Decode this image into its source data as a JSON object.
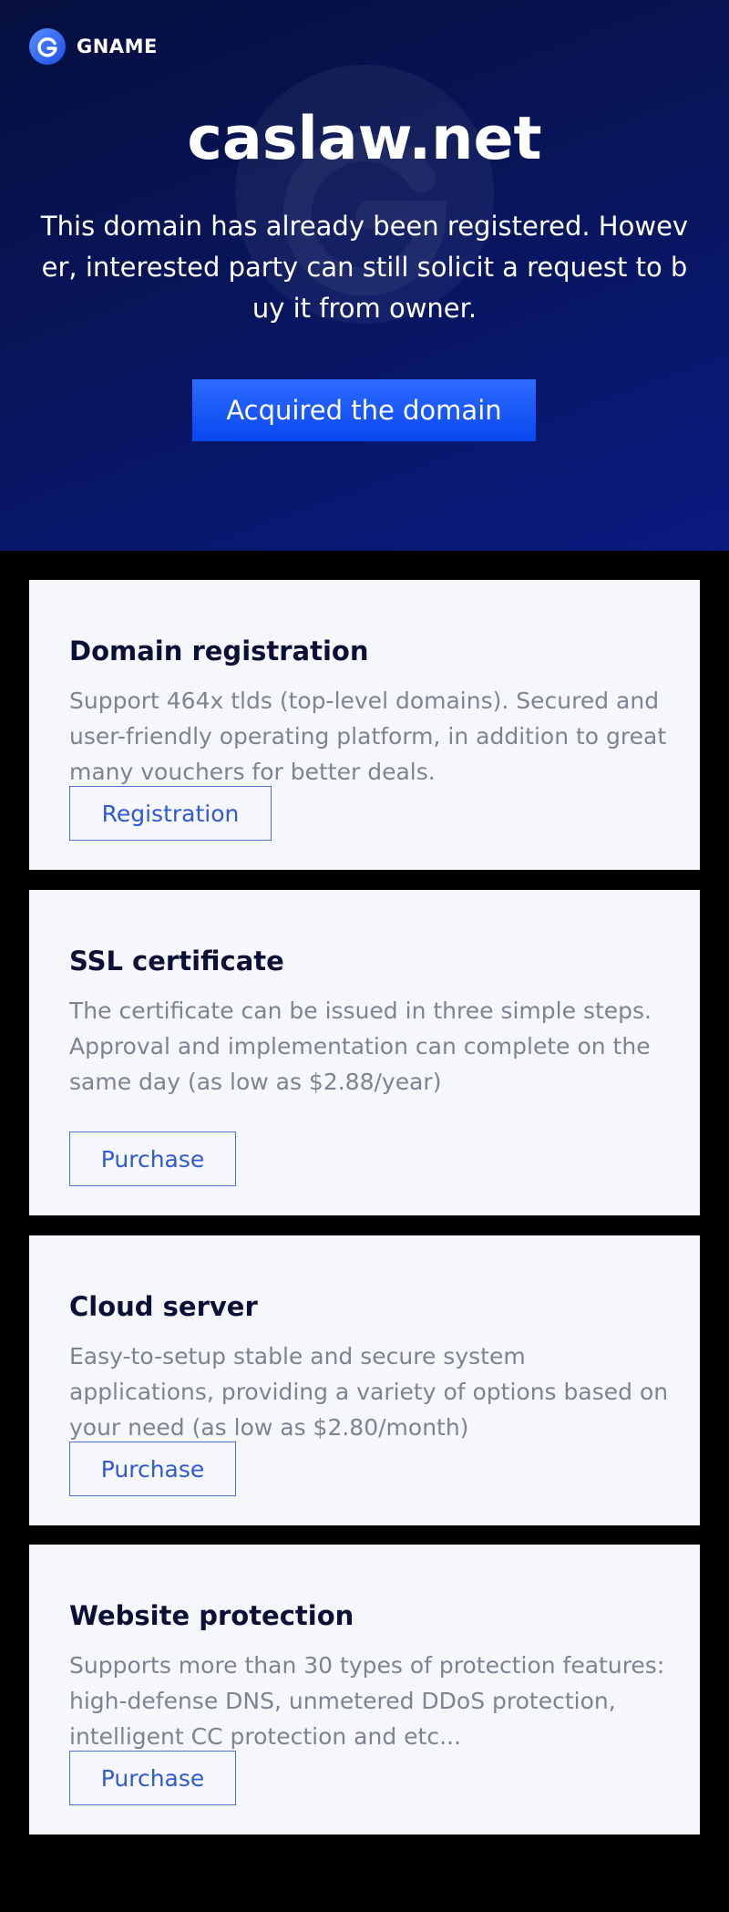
{
  "brand": {
    "logo_icon": "gname-g-logo-icon",
    "name": "GNAME"
  },
  "hero": {
    "domain": "caslaw.net",
    "description": "This domain has already been registered. However, interested party can still solicit a request to buy it from owner.",
    "button_label": "Acquired the domain"
  },
  "services": [
    {
      "title": "Domain registration",
      "description": "Support 464x tlds (top-level domains). Secured and user-friendly operating platform, in addition to great many vouchers for better deals.",
      "button_label": "Registration"
    },
    {
      "title": "SSL certificate",
      "description": "The certificate can be issued in three simple steps. Approval and implementation can complete on the same day (as low as $2.88/year)",
      "button_label": "Purchase"
    },
    {
      "title": "Cloud server",
      "description": "Easy-to-setup stable and secure system applications, providing a variety of options based on your need (as low as $2.80/month)",
      "button_label": "Purchase"
    },
    {
      "title": "Website protection",
      "description": "Supports more than 30 types of protection features: high-defense DNS, unmetered DDoS protection, intelligent CC protection and etc...",
      "button_label": "Purchase"
    }
  ],
  "colors": {
    "hero_background": "#08155a",
    "primary_button": "#0a47f0",
    "card_background": "#f6f7fb",
    "card_title": "#0b1136",
    "card_text": "#7f8391",
    "outline_button": "#2f59d6",
    "page_background": "#000000"
  }
}
